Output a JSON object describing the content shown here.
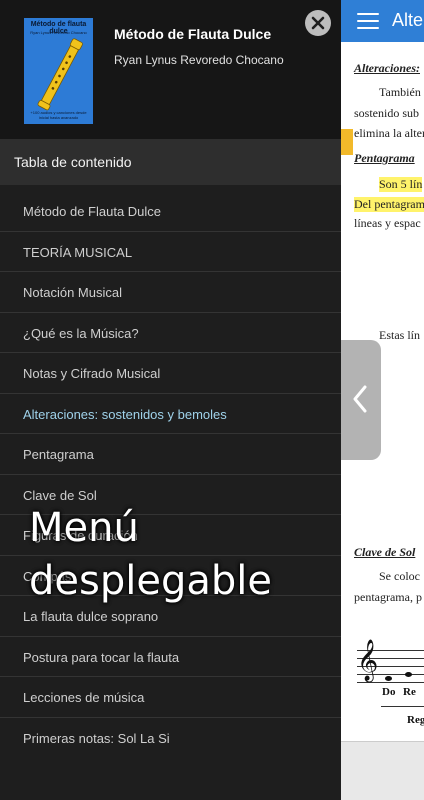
{
  "app": {
    "colors": {
      "accent": "#2f7fd6",
      "drawer_bg": "#1e1e1e",
      "active_item": "#9fd2ea",
      "highlight": "#fff36b"
    }
  },
  "drawer": {
    "book_title": "Método de Flauta Dulce",
    "book_author": "Ryan Lynus Revoredo Chocano",
    "cover": {
      "title": "Método de flauta dulce",
      "author": "Ryan Lynus Revoredo Chocano",
      "footer": "+100 audios y canciones desde inicial hasta avanzado"
    },
    "close_icon": "close-icon",
    "toc_title": "Tabla de contenido",
    "items": [
      {
        "label": "Método de Flauta Dulce",
        "active": false
      },
      {
        "label": "TEORÍA MUSICAL",
        "active": false
      },
      {
        "label": "Notación Musical",
        "active": false
      },
      {
        "label": "¿Qué es la Música?",
        "active": false
      },
      {
        "label": "Notas y Cifrado Musical",
        "active": false
      },
      {
        "label": "Alteraciones: sostenidos y bemoles",
        "active": true
      },
      {
        "label": "Pentagrama",
        "active": false
      },
      {
        "label": "Clave de Sol",
        "active": false
      },
      {
        "label": "Figuras de duración",
        "active": false
      },
      {
        "label": "Compás",
        "active": false
      },
      {
        "label": "La flauta dulce soprano",
        "active": false
      },
      {
        "label": "Postura para tocar la flauta",
        "active": false
      },
      {
        "label": "Lecciones de música",
        "active": false
      },
      {
        "label": "Primeras notas: Sol La Si",
        "active": false
      }
    ]
  },
  "document": {
    "appbar_title": "Alteraciones: sostenidos y bemoles",
    "lines": [
      "Alteraciones:",
      "También",
      "sostenido sub",
      "elimina la alter",
      "Pentagrama",
      "Son 5 lín",
      "Del pentagram",
      "líneas y espac",
      "Estas lín",
      "Clave de Sol",
      "Se coloc",
      "pentagrama, p"
    ],
    "notes": [
      "Do",
      "Re"
    ],
    "partial_label": "Reg"
  },
  "overlay_caption": [
    "Menú",
    "desplegable"
  ]
}
